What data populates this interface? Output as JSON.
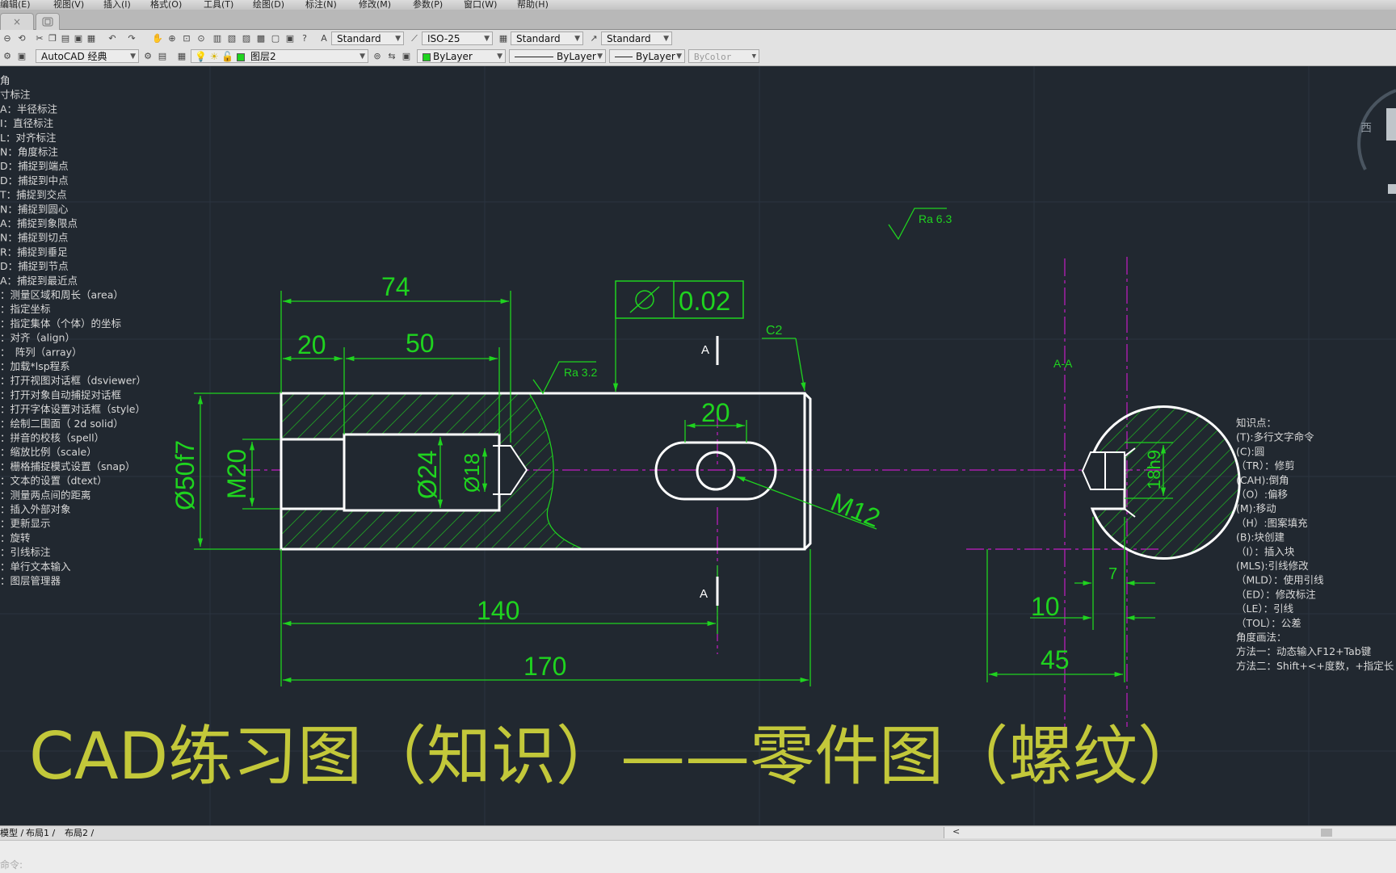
{
  "menu": [
    "编辑(E)",
    "视图(V)",
    "插入(I)",
    "格式(O)",
    "工具(T)",
    "绘图(D)",
    "标注(N)",
    "修改(M)",
    "参数(P)",
    "窗口(W)",
    "帮助(H)"
  ],
  "doc_tabs": {
    "close_glyph": "×"
  },
  "toolbar1": {
    "text_style": "Standard",
    "dim_style": "ISO-25",
    "table_style": "Standard",
    "mleader_style": "Standard"
  },
  "toolbar2": {
    "workspace": "AutoCAD 经典",
    "layer": "图层2",
    "color": "ByLayer",
    "linetype": "ByLayer",
    "lineweight": "ByLayer",
    "plotstyle": "ByColor"
  },
  "left_notes": [
    "角",
    "寸标注",
    "A：半径标注",
    "I：直径标注",
    "L：对齐标注",
    "N：角度标注",
    "D：捕捉到端点",
    "D：捕捉到中点",
    "T：捕捉到交点",
    "N：捕捉到圆心",
    "A：捕捉到象限点",
    "N：捕捉到切点",
    "R：捕捉到垂足",
    "D：捕捉到节点",
    "A：捕捉到最近点",
    "：测量区域和周长（area）",
    "：指定坐标",
    "：指定集体（个体）的坐标",
    "：对齐（align）",
    "：　阵列（array）",
    "：加载*lsp程系",
    "：打开视图对话框（dsviewer）",
    "：打开对象自动捕捉对话框",
    "：打开字体设置对话框（style）",
    "：绘制二围面（ 2d solid）",
    "：拼音的校核（spell）",
    "：缩放比例（scale）",
    "：栅格捕捉模式设置（snap）",
    "：文本的设置（dtext）",
    "：测量两点间的距离",
    "：插入外部对象",
    "：更新显示",
    "：旋转",
    "：引线标注",
    "：单行文本输入",
    "：图层管理器"
  ],
  "right_notes": [
    "知识点：",
    "(T):多行文字命令",
    "(C):圆",
    "（TR）：修剪",
    "(CAH):倒角",
    "（O）:偏移",
    "(M):移动",
    "（H）:图案填充",
    "(B):块创建",
    "（I）：插入块",
    "(MLS):引线修改",
    "（MLD）：使用引线",
    "（ED）：修改标注",
    "（LE）：引线",
    "（TOL）：公差",
    "角度画法：",
    "方法一：动态输入F12+Tab键",
    "方法二：Shift+<+度数，+指定长"
  ],
  "dimensions": {
    "d74": "74",
    "d20a": "20",
    "d50": "50",
    "d20b": "20",
    "d140": "140",
    "d170": "170",
    "d50f7": "Ø50f7",
    "m20": "M20",
    "d24": "Ø24",
    "d18": "Ø18",
    "m12": "M12",
    "d18h9": "18h9",
    "d7": "7",
    "d10": "10",
    "d45": "45"
  },
  "annotations": {
    "tolerance_value": "0.02",
    "chamfer": "C2",
    "roughness1": "Ra 6.3",
    "roughness2": "Ra 3.2",
    "section_a_top": "A",
    "section_a_bottom": "A",
    "section_title": "A-A"
  },
  "viewcube": {
    "west_label": "西"
  },
  "caption": "CAD练习图（知识）——零件图（螺纹）",
  "layout_tabs": [
    "模型",
    "布局1",
    "布局2"
  ],
  "scroll_arrow": "<",
  "command_prompt": "命令:",
  "colors": {
    "background": "#212830",
    "dimension": "#1fd31f",
    "centerline": "#c41dc4",
    "outline": "#ffffff",
    "caption": "#c3c83a"
  }
}
